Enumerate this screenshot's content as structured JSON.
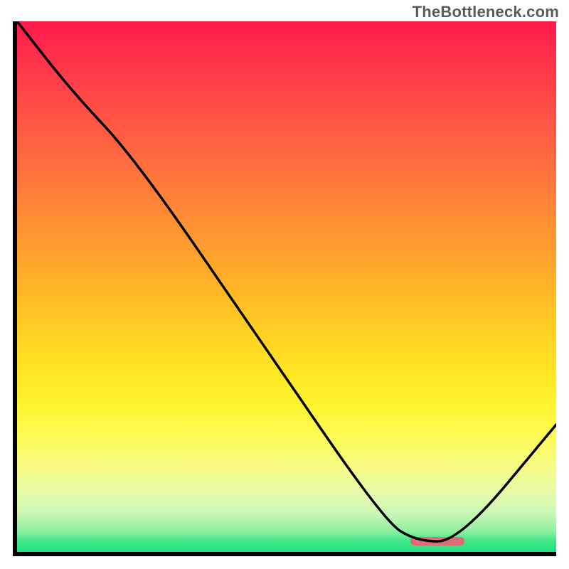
{
  "attribution": "TheBottleneck.com",
  "chart_data": {
    "type": "line",
    "title": "",
    "xlabel": "",
    "ylabel": "",
    "xlim": [
      0,
      100
    ],
    "ylim": [
      0,
      100
    ],
    "x": [
      0,
      10,
      22,
      45,
      68,
      74,
      82,
      100
    ],
    "values": [
      100,
      87,
      74,
      40,
      6,
      2,
      2,
      24
    ],
    "optimal_range": {
      "start": 73,
      "end": 83,
      "y": 2
    }
  },
  "colors": {
    "curve": "#000000",
    "marker": "#df6b76",
    "axis": "#000000"
  }
}
